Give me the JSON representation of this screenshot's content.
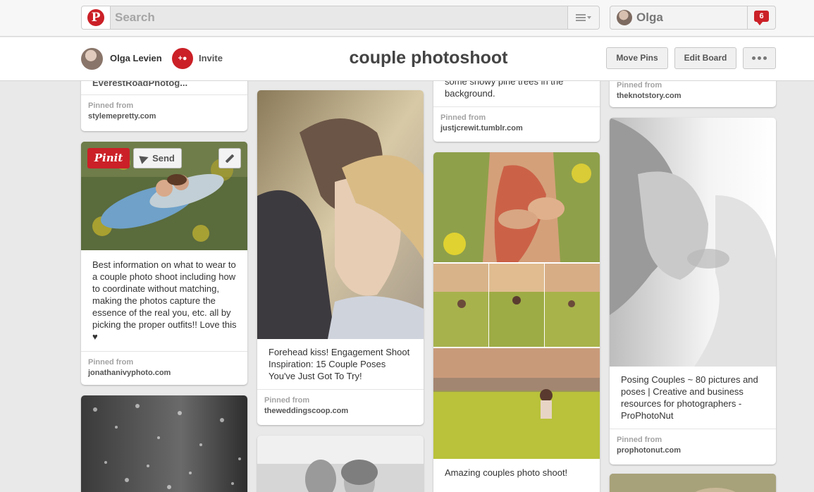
{
  "topbar": {
    "logo_letter": "P",
    "search_placeholder": "Search",
    "user_name": "Olga",
    "notification_count": "6"
  },
  "board": {
    "owner_name": "Olga Levien",
    "invite_label": "Invite",
    "title": "couple photoshoot",
    "move_pins_label": "Move Pins",
    "edit_board_label": "Edit Board"
  },
  "pin_actions": {
    "pinit_label": "Pinit",
    "send_label": "Send"
  },
  "pins": {
    "col1_top": {
      "desc_partial": "EverestRoadPhotog...",
      "source_label": "Pinned from",
      "source": "stylemepretty.com"
    },
    "col1_b": {
      "description": "Best information on what to wear to a couple photo shoot including how to coordinate without matching, making the photos capture the essence of the real you, etc. all by picking the proper outfits!! Love this ♥",
      "source_label": "Pinned from",
      "source": "jonathanivyphoto.com"
    },
    "col2_a": {
      "description": "Forehead kiss! Engagement Shoot Inspiration: 15 Couple Poses You've Just Got To Try!",
      "source_label": "Pinned from",
      "source": "theweddingscoop.com"
    },
    "col3_top": {
      "desc_partial": "some snowy pine trees in the background.",
      "source_label": "Pinned from",
      "source": "justjcrewit.tumblr.com"
    },
    "col3_b": {
      "description": "Amazing couples photo shoot!"
    },
    "col4_top": {
      "source_label": "Pinned from",
      "source": "theknotstory.com"
    },
    "col4_b": {
      "description": "Posing Couples ~ 80 pictures and poses | Creative and business resources for photographers - ProPhotoNut",
      "source_label": "Pinned from",
      "source": "prophotonut.com"
    }
  },
  "colors": {
    "brand_red": "#cb2027",
    "background": "#e9e9e9"
  }
}
